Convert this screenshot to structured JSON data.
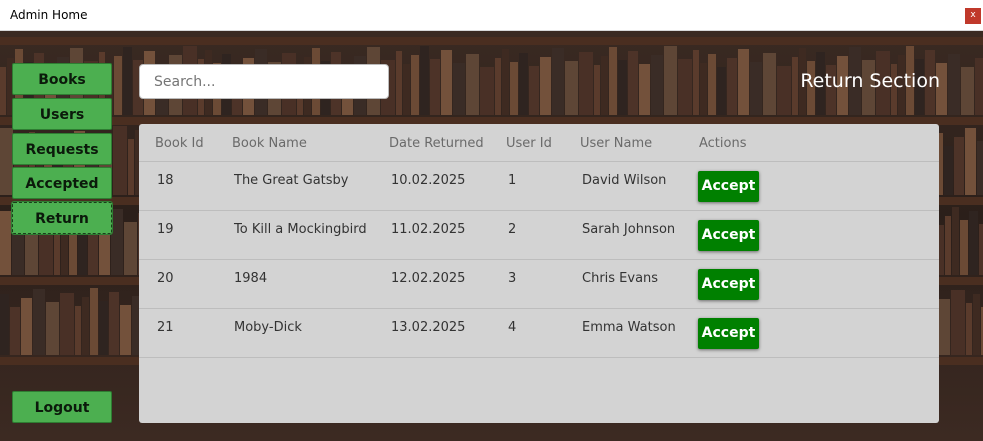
{
  "window": {
    "title": "Admin Home",
    "close_label": "x"
  },
  "sidebar": {
    "items": [
      {
        "label": "Books"
      },
      {
        "label": "Users"
      },
      {
        "label": "Requests"
      },
      {
        "label": "Accepted"
      },
      {
        "label": "Return",
        "active": true
      }
    ],
    "logout_label": "Logout"
  },
  "search": {
    "placeholder": "Search...",
    "value": ""
  },
  "section_title": "Return Section",
  "table": {
    "columns": [
      "Book Id",
      "Book Name",
      "Date Returned",
      "User Id",
      "User Name",
      "Actions"
    ],
    "rows": [
      {
        "book_id": "18",
        "book_name": "The Great Gatsby",
        "date_returned": "10.02.2025",
        "user_id": "1",
        "user_name": "David Wilson",
        "action": "Accept"
      },
      {
        "book_id": "19",
        "book_name": "To Kill a Mockingbird",
        "date_returned": "11.02.2025",
        "user_id": "2",
        "user_name": "Sarah Johnson",
        "action": "Accept"
      },
      {
        "book_id": "20",
        "book_name": "1984",
        "date_returned": "12.02.2025",
        "user_id": "3",
        "user_name": "Chris Evans",
        "action": "Accept"
      },
      {
        "book_id": "21",
        "book_name": "Moby-Dick",
        "date_returned": "13.02.2025",
        "user_id": "4",
        "user_name": "Emma Watson",
        "action": "Accept"
      }
    ]
  },
  "colors": {
    "nav_green": "#4caf50",
    "accept_green": "#008000",
    "panel": "#d3d3d3"
  }
}
